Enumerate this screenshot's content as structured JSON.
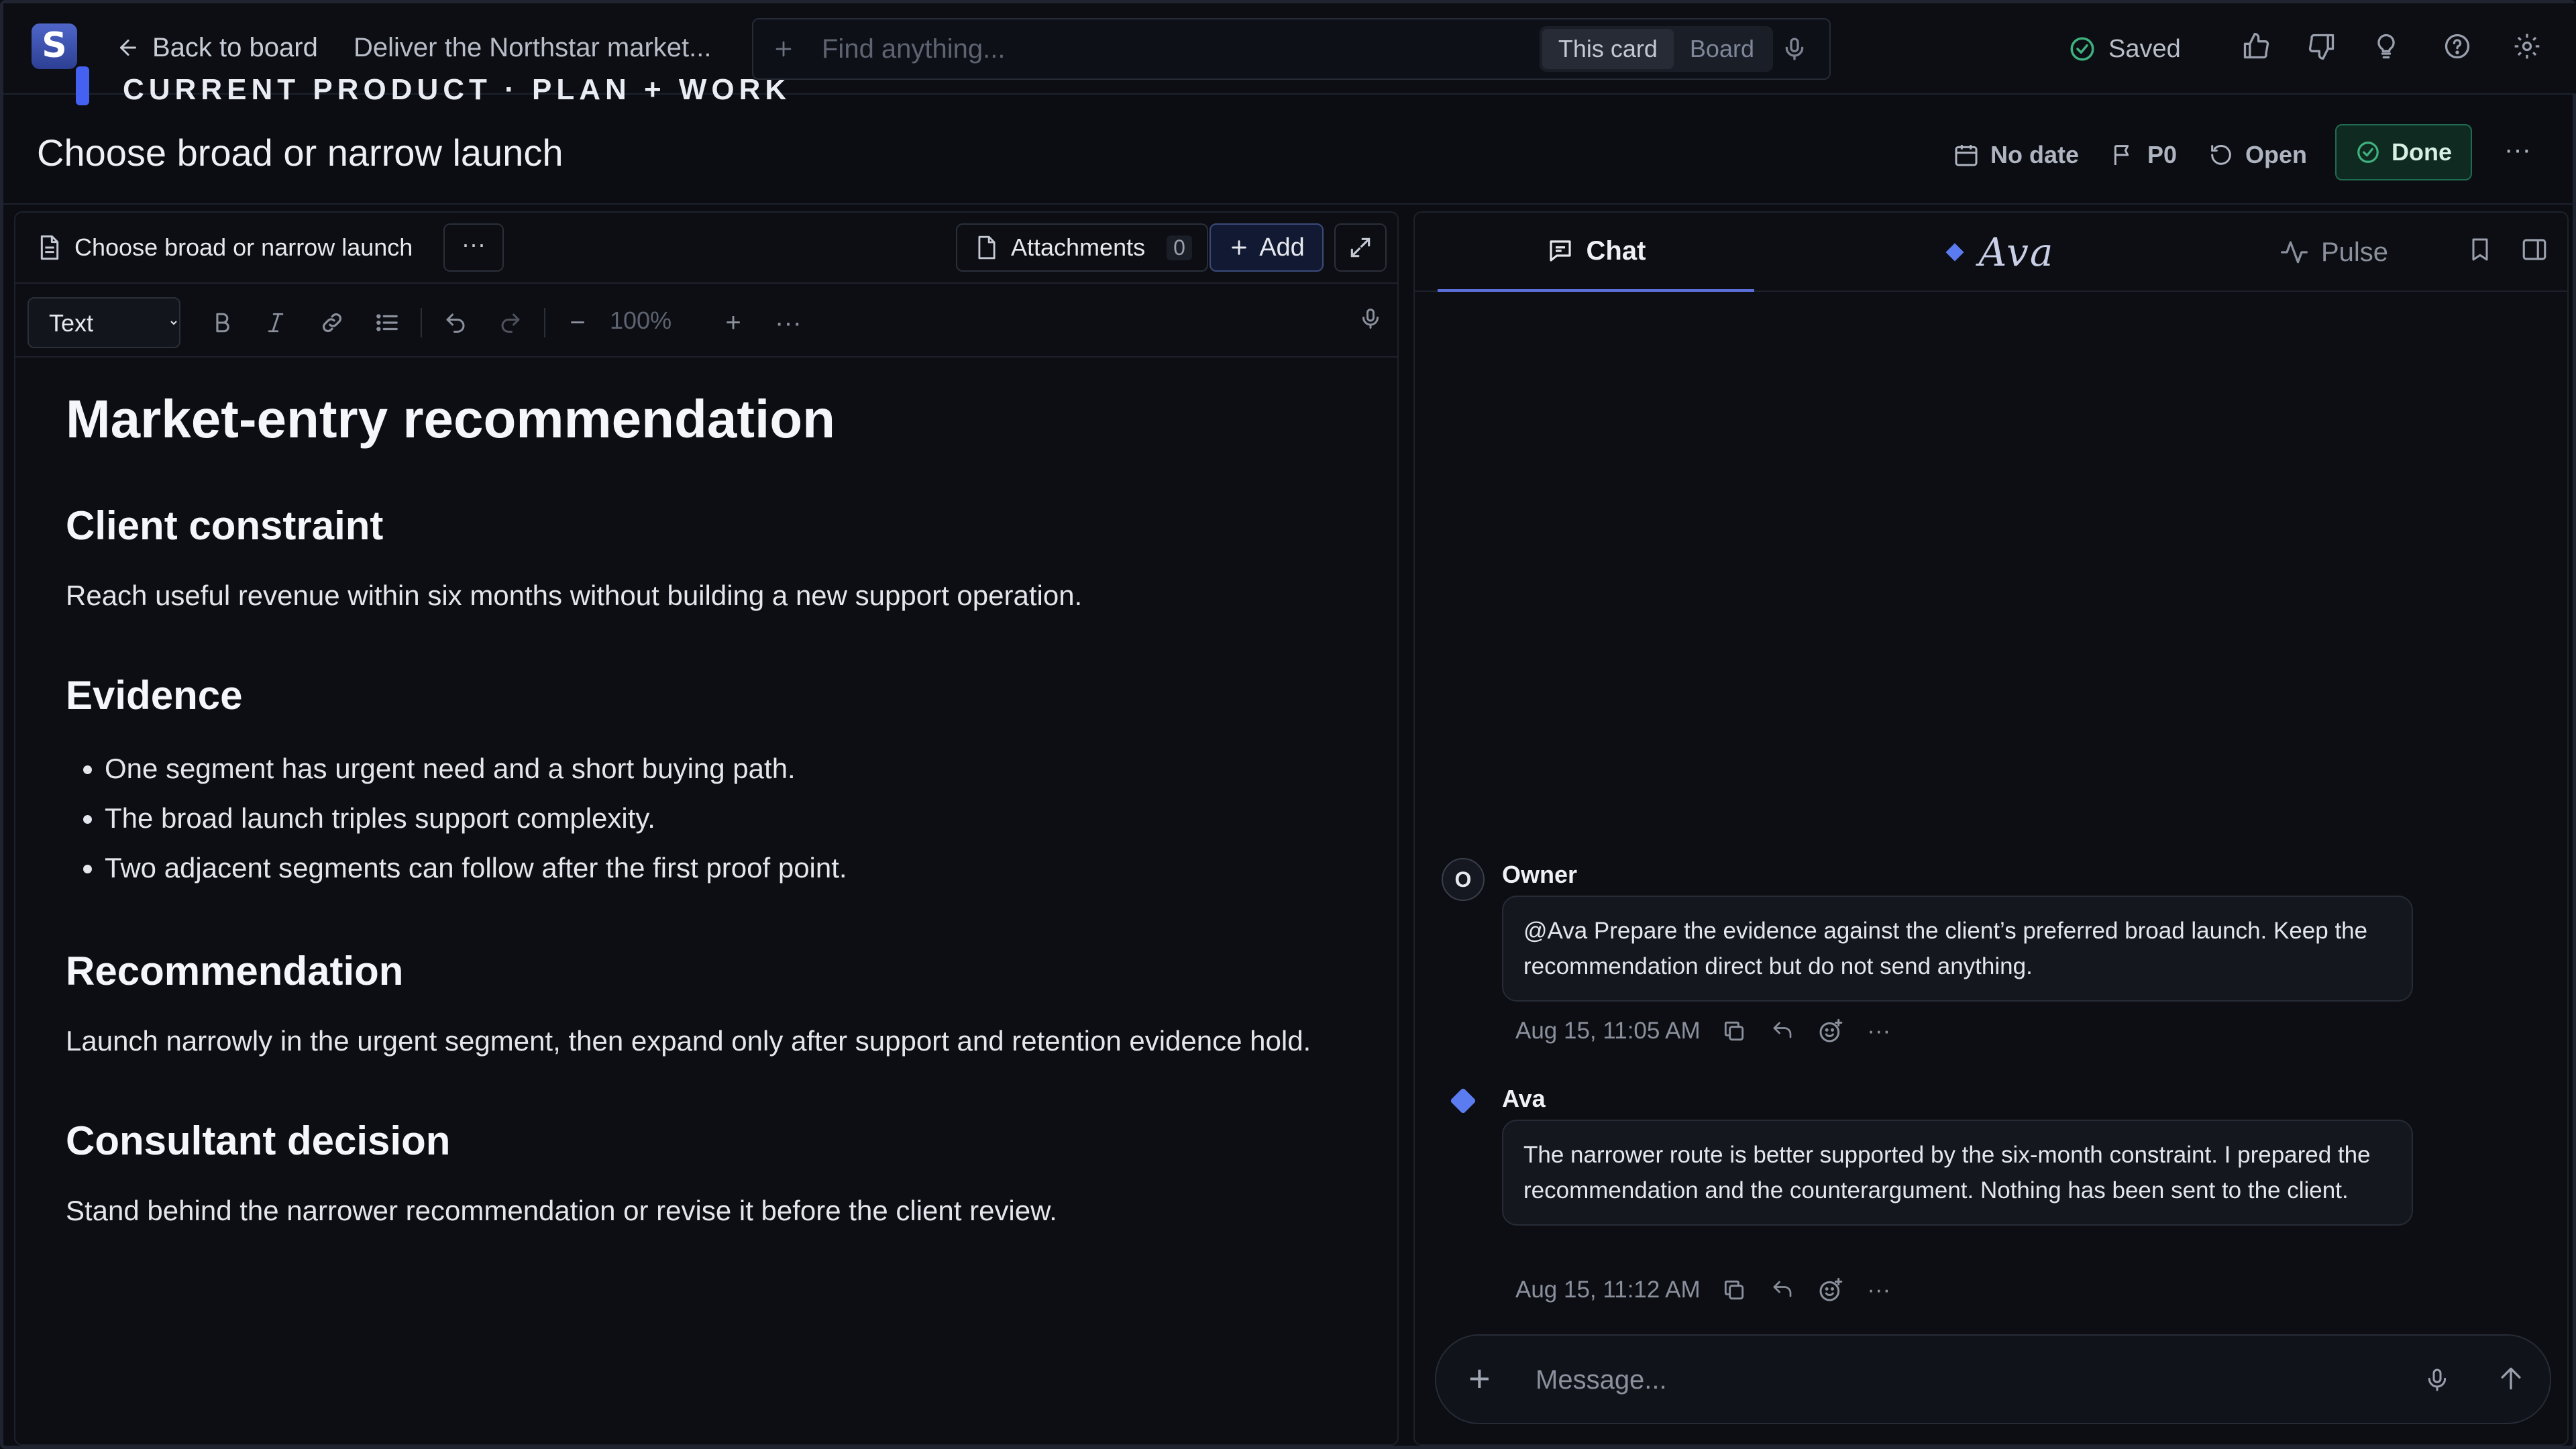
{
  "topbar": {
    "logo_letter": "S",
    "back_label": "Back to board",
    "breadcrumb": "Deliver the Northstar market...",
    "workspace_label": "CURRENT PRODUCT · PLAN + WORK",
    "search_placeholder": "Find anything...",
    "scope_options": [
      "This card",
      "Board"
    ],
    "scope_selected": "This card",
    "saved_label": "Saved",
    "icons": [
      "thumbs-up-icon",
      "thumbs-down-icon",
      "lightbulb-icon",
      "help-icon",
      "settings-icon"
    ]
  },
  "card": {
    "title": "Choose broad or narrow launch",
    "due": "No date",
    "priority": "P0",
    "status": "Open",
    "done_label": "Done",
    "more": "···"
  },
  "editor": {
    "doc_name": "Choose broad or narrow launch",
    "doc_more": "···",
    "attachments_label": "Attachments",
    "attachments_count": "0",
    "add_label": "Add",
    "format_options": [
      "Text"
    ],
    "format_selected": "Text",
    "zoom_minus": "−",
    "zoom": "100%",
    "zoom_plus": "+",
    "toolbar_more": "···",
    "content": {
      "title": "Market-entry recommendation",
      "sections": [
        {
          "heading": "Client constraint",
          "text": "Reach useful revenue within six months without building a new support operation."
        },
        {
          "heading": "Evidence",
          "bullets": [
            "One segment has urgent need and a short buying path.",
            "The broad launch triples support complexity.",
            "Two adjacent segments can follow after the first proof point."
          ]
        },
        {
          "heading": "Recommendation",
          "text": "Launch narrowly in the urgent segment, then expand only after support and retention evidence hold."
        },
        {
          "heading": "Consultant decision",
          "text": "Stand behind the narrower recommendation or revise it before the client review."
        }
      ]
    }
  },
  "chat": {
    "tabs": [
      {
        "label": "Chat",
        "icon": "chat-icon",
        "active": true
      },
      {
        "label": "Ava",
        "icon": "ava-diamond-icon",
        "active": false
      },
      {
        "label": "Pulse",
        "icon": "pulse-icon",
        "active": false
      }
    ],
    "messages": [
      {
        "author": "Owner",
        "avatar": "O",
        "text": "@Ava Prepare the evidence against the client’s preferred broad launch. Keep the recommendation direct but do not send anything.",
        "time": "Aug 15, 11:05 AM"
      },
      {
        "author": "Ava",
        "avatar": "",
        "text": "The narrower route is better supported by the six-month constraint. I prepared the recommendation and the counterargument. Nothing has been sent to the client.",
        "time": "Aug 15, 11:12 AM"
      }
    ],
    "message_meta_more": "···",
    "composer_plus": "+",
    "composer_placeholder": "Message..."
  },
  "colors": {
    "background": "#0b0d12",
    "panel": "#0c0e13",
    "accent": "#5a6fd8",
    "done_green": "#1f6b4e",
    "saved_green": "#3fb27f",
    "ava_blue": "#5b7cf0"
  }
}
